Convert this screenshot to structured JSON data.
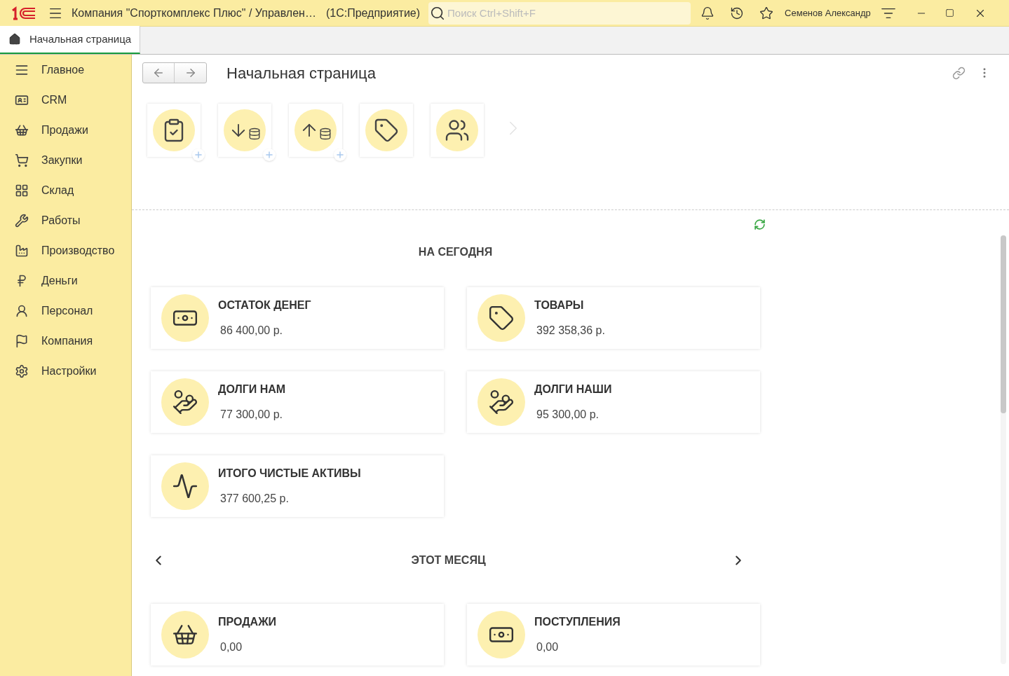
{
  "window": {
    "title": "Компания \"Спорткомплекс Плюс\" / Управлен…",
    "app": "(1С:Предприятие)",
    "search_placeholder": "Поиск Ctrl+Shift+F",
    "user": "Семенов Александр"
  },
  "tabs": [
    {
      "label": "Начальная страница",
      "selected": true
    }
  ],
  "sidebar": {
    "items": [
      {
        "label": "Главное",
        "selected": false
      },
      {
        "label": "CRM",
        "selected": false
      },
      {
        "label": "Продажи",
        "selected": false
      },
      {
        "label": "Закупки",
        "selected": false
      },
      {
        "label": "Склад",
        "selected": false
      },
      {
        "label": "Работы",
        "selected": false
      },
      {
        "label": "Производство",
        "selected": false
      },
      {
        "label": "Деньги",
        "selected": false
      },
      {
        "label": "Персонал",
        "selected": false
      },
      {
        "label": "Компания",
        "selected": false
      },
      {
        "label": "Настройки",
        "selected": false
      }
    ]
  },
  "page": {
    "title": "Начальная страница"
  },
  "quick_tiles": [
    {
      "kind": "clipboard",
      "add": true
    },
    {
      "kind": "income",
      "add": true
    },
    {
      "kind": "outcome",
      "add": true
    },
    {
      "kind": "tag",
      "add": false
    },
    {
      "kind": "people",
      "add": false
    }
  ],
  "sections": [
    {
      "title": "НА СЕГОДНЯ",
      "nav": false,
      "cards": [
        {
          "kind": "money",
          "title": "ОСТАТОК ДЕНЕГ",
          "value": "86 400,00 р."
        },
        {
          "kind": "tag",
          "title": "ТОВАРЫ",
          "value": "392 358,36 р."
        },
        {
          "kind": "hand",
          "title": "ДОЛГИ НАМ",
          "value": "77 300,00 р."
        },
        {
          "kind": "hand",
          "title": "ДОЛГИ НАШИ",
          "value": "95 300,00 р."
        },
        {
          "kind": "chart",
          "title": "ИТОГО ЧИСТЫЕ АКТИВЫ",
          "value": "377 600,25 р."
        }
      ]
    },
    {
      "title": "ЭТОТ МЕСЯЦ",
      "nav": true,
      "cards": [
        {
          "kind": "basket",
          "title": "ПРОДАЖИ",
          "value": "0,00"
        },
        {
          "kind": "money",
          "title": "ПОСТУПЛЕНИЯ",
          "value": "0,00"
        }
      ]
    }
  ]
}
